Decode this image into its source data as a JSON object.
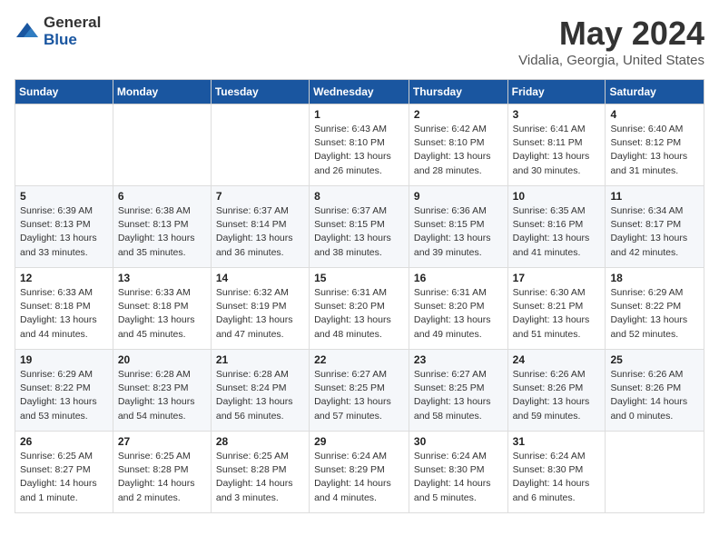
{
  "logo": {
    "general": "General",
    "blue": "Blue"
  },
  "title": "May 2024",
  "subtitle": "Vidalia, Georgia, United States",
  "days_of_week": [
    "Sunday",
    "Monday",
    "Tuesday",
    "Wednesday",
    "Thursday",
    "Friday",
    "Saturday"
  ],
  "weeks": [
    [
      {
        "day": "",
        "detail": ""
      },
      {
        "day": "",
        "detail": ""
      },
      {
        "day": "",
        "detail": ""
      },
      {
        "day": "1",
        "detail": "Sunrise: 6:43 AM\nSunset: 8:10 PM\nDaylight: 13 hours\nand 26 minutes."
      },
      {
        "day": "2",
        "detail": "Sunrise: 6:42 AM\nSunset: 8:10 PM\nDaylight: 13 hours\nand 28 minutes."
      },
      {
        "day": "3",
        "detail": "Sunrise: 6:41 AM\nSunset: 8:11 PM\nDaylight: 13 hours\nand 30 minutes."
      },
      {
        "day": "4",
        "detail": "Sunrise: 6:40 AM\nSunset: 8:12 PM\nDaylight: 13 hours\nand 31 minutes."
      }
    ],
    [
      {
        "day": "5",
        "detail": "Sunrise: 6:39 AM\nSunset: 8:13 PM\nDaylight: 13 hours\nand 33 minutes."
      },
      {
        "day": "6",
        "detail": "Sunrise: 6:38 AM\nSunset: 8:13 PM\nDaylight: 13 hours\nand 35 minutes."
      },
      {
        "day": "7",
        "detail": "Sunrise: 6:37 AM\nSunset: 8:14 PM\nDaylight: 13 hours\nand 36 minutes."
      },
      {
        "day": "8",
        "detail": "Sunrise: 6:37 AM\nSunset: 8:15 PM\nDaylight: 13 hours\nand 38 minutes."
      },
      {
        "day": "9",
        "detail": "Sunrise: 6:36 AM\nSunset: 8:15 PM\nDaylight: 13 hours\nand 39 minutes."
      },
      {
        "day": "10",
        "detail": "Sunrise: 6:35 AM\nSunset: 8:16 PM\nDaylight: 13 hours\nand 41 minutes."
      },
      {
        "day": "11",
        "detail": "Sunrise: 6:34 AM\nSunset: 8:17 PM\nDaylight: 13 hours\nand 42 minutes."
      }
    ],
    [
      {
        "day": "12",
        "detail": "Sunrise: 6:33 AM\nSunset: 8:18 PM\nDaylight: 13 hours\nand 44 minutes."
      },
      {
        "day": "13",
        "detail": "Sunrise: 6:33 AM\nSunset: 8:18 PM\nDaylight: 13 hours\nand 45 minutes."
      },
      {
        "day": "14",
        "detail": "Sunrise: 6:32 AM\nSunset: 8:19 PM\nDaylight: 13 hours\nand 47 minutes."
      },
      {
        "day": "15",
        "detail": "Sunrise: 6:31 AM\nSunset: 8:20 PM\nDaylight: 13 hours\nand 48 minutes."
      },
      {
        "day": "16",
        "detail": "Sunrise: 6:31 AM\nSunset: 8:20 PM\nDaylight: 13 hours\nand 49 minutes."
      },
      {
        "day": "17",
        "detail": "Sunrise: 6:30 AM\nSunset: 8:21 PM\nDaylight: 13 hours\nand 51 minutes."
      },
      {
        "day": "18",
        "detail": "Sunrise: 6:29 AM\nSunset: 8:22 PM\nDaylight: 13 hours\nand 52 minutes."
      }
    ],
    [
      {
        "day": "19",
        "detail": "Sunrise: 6:29 AM\nSunset: 8:22 PM\nDaylight: 13 hours\nand 53 minutes."
      },
      {
        "day": "20",
        "detail": "Sunrise: 6:28 AM\nSunset: 8:23 PM\nDaylight: 13 hours\nand 54 minutes."
      },
      {
        "day": "21",
        "detail": "Sunrise: 6:28 AM\nSunset: 8:24 PM\nDaylight: 13 hours\nand 56 minutes."
      },
      {
        "day": "22",
        "detail": "Sunrise: 6:27 AM\nSunset: 8:25 PM\nDaylight: 13 hours\nand 57 minutes."
      },
      {
        "day": "23",
        "detail": "Sunrise: 6:27 AM\nSunset: 8:25 PM\nDaylight: 13 hours\nand 58 minutes."
      },
      {
        "day": "24",
        "detail": "Sunrise: 6:26 AM\nSunset: 8:26 PM\nDaylight: 13 hours\nand 59 minutes."
      },
      {
        "day": "25",
        "detail": "Sunrise: 6:26 AM\nSunset: 8:26 PM\nDaylight: 14 hours\nand 0 minutes."
      }
    ],
    [
      {
        "day": "26",
        "detail": "Sunrise: 6:25 AM\nSunset: 8:27 PM\nDaylight: 14 hours\nand 1 minute."
      },
      {
        "day": "27",
        "detail": "Sunrise: 6:25 AM\nSunset: 8:28 PM\nDaylight: 14 hours\nand 2 minutes."
      },
      {
        "day": "28",
        "detail": "Sunrise: 6:25 AM\nSunset: 8:28 PM\nDaylight: 14 hours\nand 3 minutes."
      },
      {
        "day": "29",
        "detail": "Sunrise: 6:24 AM\nSunset: 8:29 PM\nDaylight: 14 hours\nand 4 minutes."
      },
      {
        "day": "30",
        "detail": "Sunrise: 6:24 AM\nSunset: 8:30 PM\nDaylight: 14 hours\nand 5 minutes."
      },
      {
        "day": "31",
        "detail": "Sunrise: 6:24 AM\nSunset: 8:30 PM\nDaylight: 14 hours\nand 6 minutes."
      },
      {
        "day": "",
        "detail": ""
      }
    ]
  ]
}
